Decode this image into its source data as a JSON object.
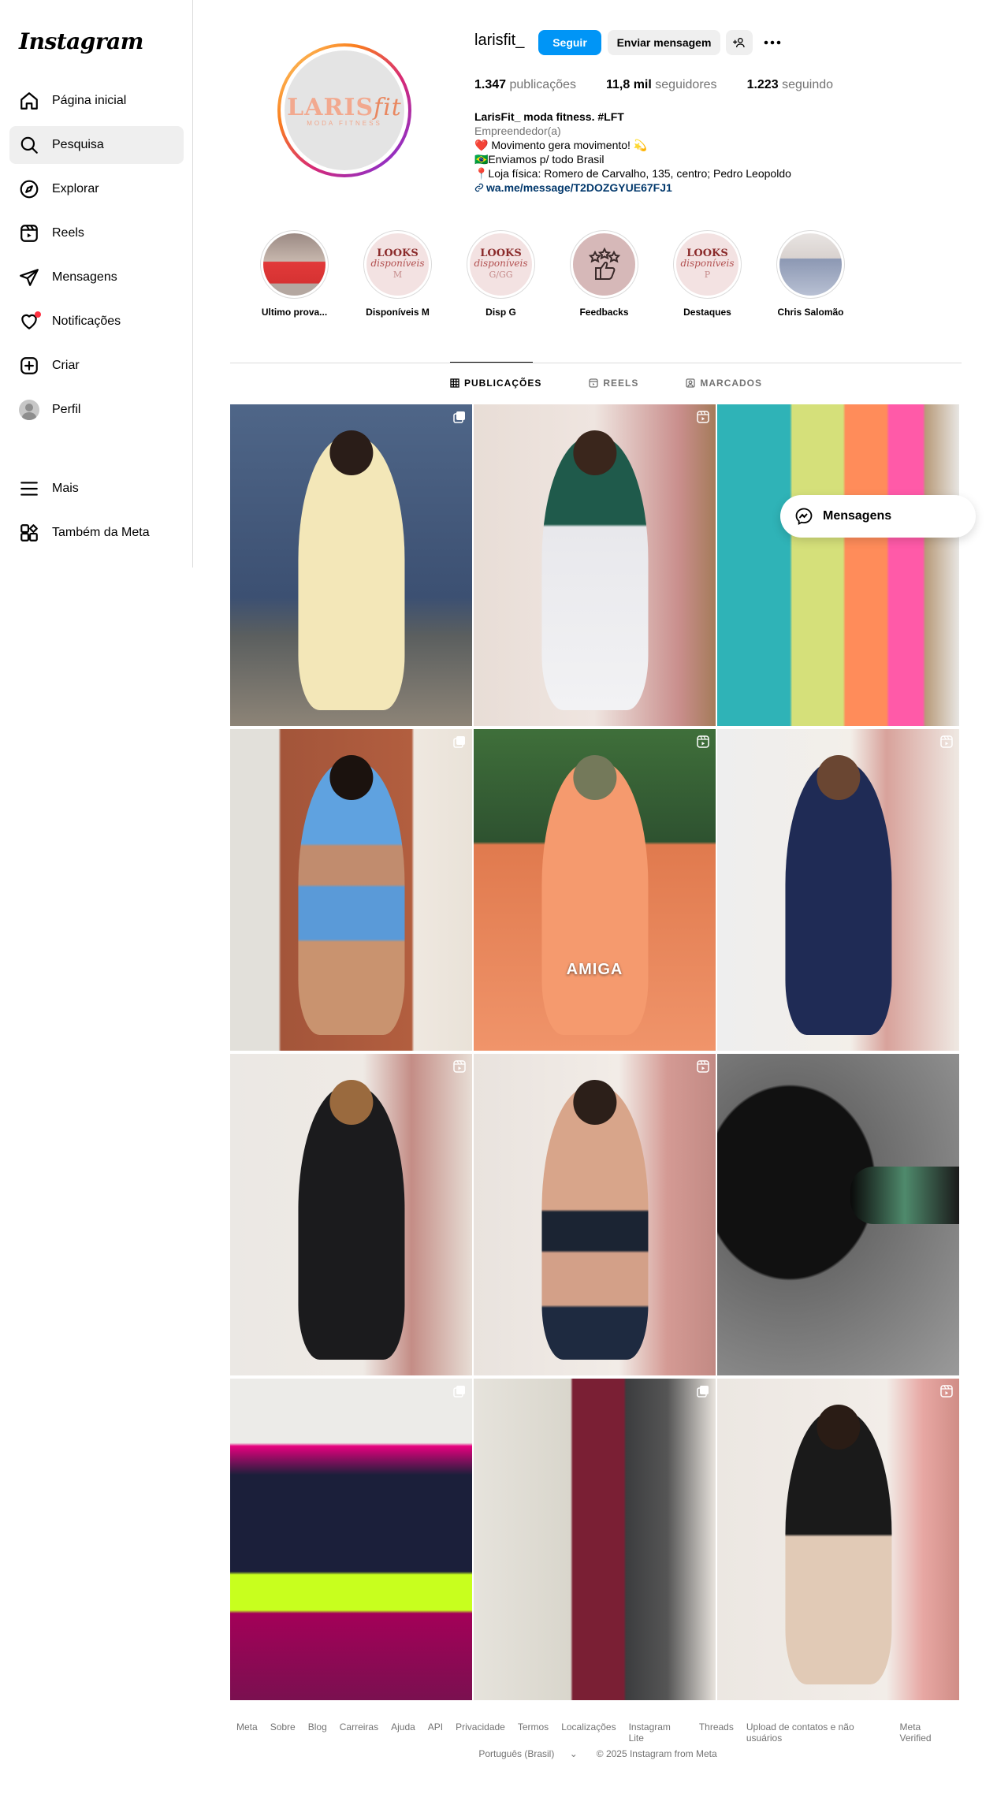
{
  "sidebar": {
    "logo": "Instagram",
    "items": [
      {
        "label": "Página inicial",
        "icon": "home-icon"
      },
      {
        "label": "Pesquisa",
        "icon": "search-icon"
      },
      {
        "label": "Explorar",
        "icon": "compass-icon"
      },
      {
        "label": "Reels",
        "icon": "reels-icon"
      },
      {
        "label": "Mensagens",
        "icon": "send-icon"
      },
      {
        "label": "Notificações",
        "icon": "heart-icon"
      },
      {
        "label": "Criar",
        "icon": "plus-icon"
      },
      {
        "label": "Perfil",
        "icon": "avatar"
      }
    ],
    "bottom": [
      {
        "label": "Mais",
        "icon": "menu-icon"
      },
      {
        "label": "Também da Meta",
        "icon": "meta-apps-icon"
      }
    ]
  },
  "profile": {
    "username": "larisfit_",
    "logo_text_main": "LARIS",
    "logo_text_fit": "fit",
    "logo_text_sub": "MODA FITNESS",
    "follow_label": "Seguir",
    "message_label": "Enviar mensagem",
    "stats": [
      {
        "value": "1.347",
        "label": "publicações"
      },
      {
        "value": "11,8 mil",
        "label": "seguidores"
      },
      {
        "value": "1.223",
        "label": "seguindo"
      }
    ],
    "bio": {
      "name": "LarisFit_ moda fitness. #LFT",
      "category": "Empreendedor(a)",
      "lines": [
        "❤️ Movimento gera movimento! 💫",
        "🇧🇷Enviamos p/ todo Brasil",
        "📍Loja física: Romero de Carvalho, 135, centro; Pedro Leopoldo"
      ],
      "link": "wa.me/message/T2DOZGYUE67FJ1"
    }
  },
  "highlights": [
    {
      "label": "Ultimo prova..."
    },
    {
      "label": "Disponíveis M",
      "l1": "LOOKS",
      "l2": "disponíveis",
      "l3": "M"
    },
    {
      "label": "Disp G",
      "l1": "LOOKS",
      "l2": "disponíveis",
      "l3": "G/GG"
    },
    {
      "label": "Feedbacks"
    },
    {
      "label": "Destaques",
      "l1": "LOOKS",
      "l2": "disponíveis",
      "l3": "P"
    },
    {
      "label": "Chris Salomão"
    }
  ],
  "tabs": [
    {
      "label": "PUBLICAÇÕES"
    },
    {
      "label": "REELS"
    },
    {
      "label": "MARCADOS"
    }
  ],
  "posts": [
    {
      "type": "carousel"
    },
    {
      "type": "reel"
    },
    {
      "type": "none"
    },
    {
      "type": "carousel"
    },
    {
      "type": "reel",
      "caption": "AMIGA"
    },
    {
      "type": "reel"
    },
    {
      "type": "reel"
    },
    {
      "type": "reel"
    },
    {
      "type": "none"
    },
    {
      "type": "carousel"
    },
    {
      "type": "carousel"
    },
    {
      "type": "reel"
    }
  ],
  "messages_pill": "Mensagens",
  "footer": {
    "links": [
      "Meta",
      "Sobre",
      "Blog",
      "Carreiras",
      "Ajuda",
      "API",
      "Privacidade",
      "Termos",
      "Localizações",
      "Instagram Lite",
      "Threads",
      "Upload de contatos e não usuários",
      "Meta Verified"
    ],
    "language": "Português (Brasil)",
    "copyright": "© 2025 Instagram from Meta"
  },
  "colors": {
    "accent": "#0095f6",
    "link": "#00376b",
    "muted": "#737373",
    "notification": "#ff3040"
  }
}
